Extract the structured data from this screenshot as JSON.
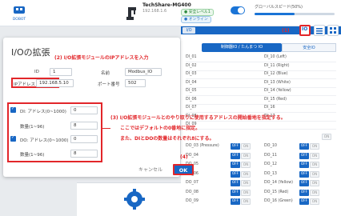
{
  "header": {
    "brand_icon": "dobot-logo",
    "device_name": "TechShare-MG400",
    "device_ip": "192.168.1.6",
    "badge_safe": "● 安全レベル1",
    "badge_online": "● オンライン",
    "speed_label": "グローバルスピード(50%)",
    "speed_percent": 50
  },
  "io_panel": {
    "tab_label": "I/O",
    "annotation_1": "(1)",
    "io_button_label": "IO",
    "subtabs": [
      "制御器IO / たんまつ IO",
      "安全IO"
    ],
    "di_rows": [
      {
        "left": "DI_01",
        "right": "DI_10 (Left)"
      },
      {
        "left": "DI_02",
        "right": "DI_11 (Right)"
      },
      {
        "left": "DI_03",
        "right": "DI_12 (Blue)"
      },
      {
        "left": "DI_04",
        "right": "DI_13 (White)"
      },
      {
        "left": "DI_05",
        "right": "DI_14 (Yellow)"
      },
      {
        "left": "DI_06",
        "right": "DI_15 (Red)"
      },
      {
        "left": "DI_07",
        "right": "DI_16"
      },
      {
        "left": "DI_08",
        "right": "DI_17"
      },
      {
        "left": "DI_09",
        "right": ""
      }
    ],
    "do_rows": [
      {
        "left": "DO_03 (Pressure)",
        "lstate": "OFF",
        "right": "DO_10",
        "rstate": "OFF"
      },
      {
        "left": "DO_04",
        "lstate": "OFF",
        "right": "DO_11",
        "rstate": "OFF"
      },
      {
        "left": "DO_05",
        "lstate": "OFF",
        "right": "DO_12",
        "rstate": "OFF"
      },
      {
        "left": "DO_06",
        "lstate": "OFF",
        "right": "DO_13",
        "rstate": "OFF"
      },
      {
        "left": "DO_07",
        "lstate": "OFF",
        "right": "DO_14 (Yellow)",
        "rstate": "OFF"
      },
      {
        "left": "DO_08",
        "lstate": "OFF",
        "right": "DO_15 (Red)",
        "rstate": "OFF"
      },
      {
        "left": "DO_09",
        "lstate": "OFF",
        "right": "DO_16 (Green)",
        "rstate": "OFF"
      }
    ],
    "on_label": "ON"
  },
  "dialog": {
    "title": "I/Oの拡張",
    "annotation_2": "(2) I/O拡張モジュールのIPアドレスを入力",
    "id_label": "ID",
    "id_value": "1",
    "name_label": "名前",
    "name_value": "Modbus_IO",
    "ip_label": "IPアドレス",
    "ip_value": "192.168.5.10",
    "port_label": "ポート番号",
    "port_value": "502",
    "di_label": "DI: アドレス(0~1000)",
    "di_value": "0",
    "di_count_label": "数量(1~96)",
    "di_count_value": "8",
    "do_label": "DO: アドレス(0~1000)",
    "do_value": "0",
    "do_count_label": "数量(1~96)",
    "do_count_value": "8",
    "annotation_3_line1": "(3) I/O拡張モジュールとのやり取りに使用するアドレスの開始番地を指定する。",
    "annotation_3_line2": "ここではデフォルトの0番地に指定。",
    "annotation_3_line3": "また、DIとDOの数量はそれぞれ8にする。",
    "annotation_4": "(4)",
    "cancel_label": "キャンセル",
    "ok_label": "OK"
  },
  "colors": {
    "accent": "#1867c4",
    "annotation": "#e2262a"
  }
}
